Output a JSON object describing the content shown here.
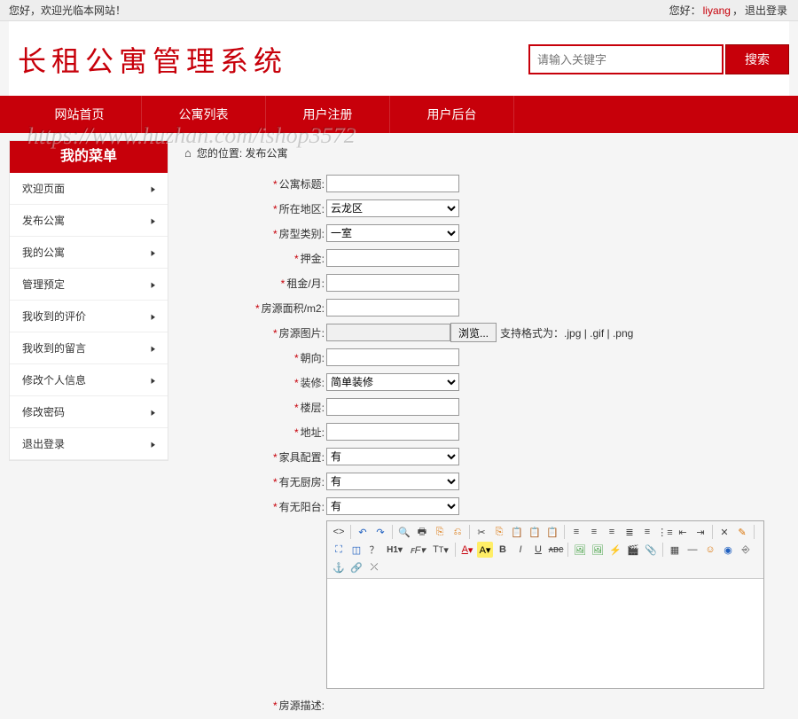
{
  "topbar": {
    "welcome": "您好，欢迎光临本网站！",
    "right_prefix": "您好：",
    "username": "liyang",
    "sep": "，",
    "logout": "退出登录"
  },
  "logo": "长租公寓管理系统",
  "search": {
    "placeholder": "请输入关键字",
    "button": "搜索"
  },
  "nav": [
    "网站首页",
    "公寓列表",
    "用户注册",
    "用户后台"
  ],
  "sidebar": {
    "title": "我的菜单",
    "items": [
      "欢迎页面",
      "发布公寓",
      "我的公寓",
      "管理预定",
      "我收到的评价",
      "我收到的留言",
      "修改个人信息",
      "修改密码",
      "退出登录"
    ]
  },
  "breadcrumb": {
    "label": "您的位置:",
    "current": "发布公寓"
  },
  "form": {
    "title": {
      "label": "公寓标题:",
      "value": ""
    },
    "district": {
      "label": "所在地区:",
      "options": [
        "云龙区"
      ],
      "value": "云龙区"
    },
    "roomtype": {
      "label": "房型类别:",
      "options": [
        "一室"
      ],
      "value": "一室"
    },
    "deposit": {
      "label": "押金:",
      "value": ""
    },
    "rent": {
      "label": "租金/月:",
      "value": ""
    },
    "area": {
      "label": "房源面积/m2:",
      "value": ""
    },
    "image": {
      "label": "房源图片:",
      "browse": "浏览...",
      "hint": "支持格式为：.jpg | .gif | .png"
    },
    "orientation": {
      "label": "朝向:",
      "value": ""
    },
    "decoration": {
      "label": "装修:",
      "options": [
        "简单装修"
      ],
      "value": "简单装修"
    },
    "floor": {
      "label": "楼层:",
      "value": ""
    },
    "address": {
      "label": "地址:",
      "value": ""
    },
    "furniture": {
      "label": "家具配置:",
      "options": [
        "有"
      ],
      "value": "有"
    },
    "kitchen": {
      "label": "有无厨房:",
      "options": [
        "有"
      ],
      "value": "有"
    },
    "balcony": {
      "label": "有无阳台:",
      "options": [
        "有"
      ],
      "value": "有"
    },
    "desc": {
      "label": "房源描述:"
    }
  },
  "watermark": "https://www.huzhan.com/ishop3572"
}
